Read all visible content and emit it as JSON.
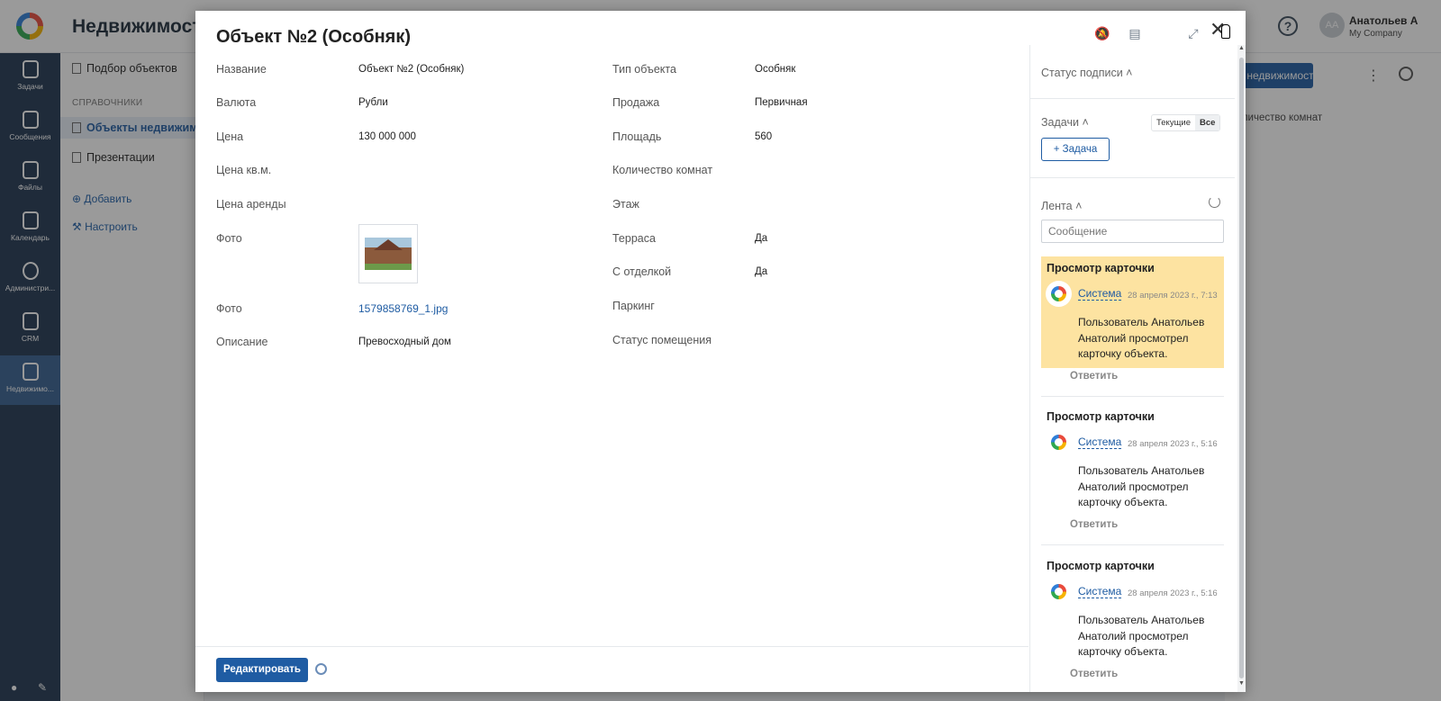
{
  "app": {
    "title": "Недвижимость",
    "user_initials": "AA",
    "user_name": "Анатольев А",
    "user_company": "My Company",
    "help_symbol": "?"
  },
  "nav": {
    "items": [
      {
        "label": "Задачи",
        "icon": "tasks-icon"
      },
      {
        "label": "Сообщения",
        "icon": "messages-icon"
      },
      {
        "label": "Файлы",
        "icon": "files-icon"
      },
      {
        "label": "Календарь",
        "icon": "calendar-icon"
      },
      {
        "label": "Администри...",
        "icon": "admin-gear-icon"
      },
      {
        "label": "CRM",
        "icon": "crm-icon"
      },
      {
        "label": "Недвижимо...",
        "icon": "real-estate-icon"
      }
    ]
  },
  "subnav": {
    "item_selection": "Подбор объектов",
    "section": "СПРАВОЧНИКИ",
    "item_objects": "Объекты недвижимости",
    "item_presentations": "Презентации",
    "add": "Добавить",
    "configure": "Настроить"
  },
  "main": {
    "add_button": "+ недвижимости",
    "column_header": "Количество комнат"
  },
  "modal": {
    "title": "Объект №2 (Особняк)",
    "fields_left": [
      {
        "label": "Название",
        "value": "Объект №2 (Особняк)"
      },
      {
        "label": "Валюта",
        "value": "Рубли"
      },
      {
        "label": "Цена",
        "value": "130 000 000"
      },
      {
        "label": "Цена кв.м.",
        "value": ""
      },
      {
        "label": "Цена аренды",
        "value": ""
      },
      {
        "label": "Фото",
        "value": ""
      },
      {
        "label": "Фото",
        "value": "1579858769_1.jpg"
      },
      {
        "label": "Описание",
        "value": "Превосходный дом"
      }
    ],
    "fields_right": [
      {
        "label": "Тип объекта",
        "value": "Особняк"
      },
      {
        "label": "Продажа",
        "value": "Первичная"
      },
      {
        "label": "Площадь",
        "value": "560"
      },
      {
        "label": "Количество комнат",
        "value": ""
      },
      {
        "label": "Этаж",
        "value": ""
      },
      {
        "label": "Терраса",
        "value": "Да"
      },
      {
        "label": "С отделкой",
        "value": "Да"
      },
      {
        "label": "Паркинг",
        "value": ""
      },
      {
        "label": "Статус помещения",
        "value": ""
      }
    ],
    "edit_button": "Редактировать"
  },
  "panel": {
    "signature_status": "Статус подписи ˄",
    "tasks": "Задачи ˄",
    "tasks_current": "Текущие",
    "tasks_all": "Все",
    "add_task": "+ Задача",
    "feed": "Лента ˄",
    "message_placeholder": "Сообщение",
    "reply": "Ответить",
    "entries": [
      {
        "title": "Просмотр карточки",
        "author": "Система",
        "date": "28 апреля 2023 г., 7:13",
        "text": "Пользователь Анатольев Анатолий просмотрел карточку объекта.",
        "highlight": true
      },
      {
        "title": "Просмотр карточки",
        "author": "Система",
        "date": "28 апреля 2023 г., 5:16",
        "text": "Пользователь Анатольев Анатолий просмотрел карточку объекта.",
        "highlight": false
      },
      {
        "title": "Просмотр карточки",
        "author": "Система",
        "date": "28 апреля 2023 г., 5:16",
        "text": "Пользователь Анатольев Анатолий просмотрел карточку объекта.",
        "highlight": false
      }
    ]
  },
  "colors": {
    "accent": "#1f5ca3",
    "nav_bg": "#1f3550",
    "highlight": "#fde3a1"
  }
}
